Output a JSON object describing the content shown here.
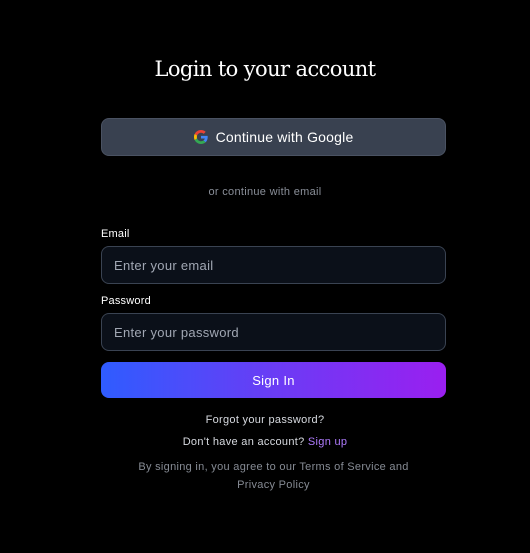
{
  "heading": "Login to your account",
  "google": {
    "label": "Continue with Google",
    "icon": "google-g-icon"
  },
  "divider": "or continue with email",
  "email": {
    "label": "Email",
    "placeholder": "Enter your email",
    "value": ""
  },
  "password": {
    "label": "Password",
    "placeholder": "Enter your password",
    "value": ""
  },
  "signin": {
    "label": "Sign In"
  },
  "forgot": "Forgot your password?",
  "signup": {
    "prompt": "Don't have an account?",
    "link": "Sign up"
  },
  "terms": "By signing in, you agree to our Terms of Service and Privacy Policy",
  "colors": {
    "background": "#000000",
    "google_button": "#394150",
    "input_bg": "#0b1019",
    "input_border": "#3a4352",
    "gradient_start": "#2f5cff",
    "gradient_end": "#9a1ff0",
    "signup_link": "#b07cff"
  }
}
